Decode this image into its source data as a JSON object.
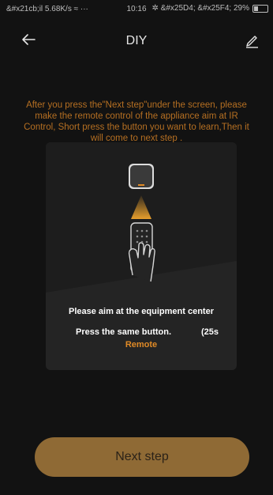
{
  "status_bar": {
    "left": "&#x21cb;il 5.68K/s ≈ ···",
    "time": "10:16",
    "right_icons": "✲ &#x25D4; &#x25F4; 29%",
    "battery_percent": 29
  },
  "nav": {
    "title": "DIY",
    "back_icon": "arrow-left-icon",
    "edit_icon": "pencil-icon"
  },
  "instructions": "After you press the\"Next step\"under the screen, please make the remote control of the appliance aim at IR Control, Short press the button you want to learn,Then it  will come to next step .",
  "card": {
    "aim_text": "Please aim at the equipment center",
    "press_text": "Press the same button.",
    "countdown": "(25s",
    "remote_label": "Remote"
  },
  "next_button": "Next step",
  "colors": {
    "background": "#121212",
    "accent_text": "#b56f22",
    "button": "#8f6a35",
    "remote_label": "#e08a26"
  }
}
